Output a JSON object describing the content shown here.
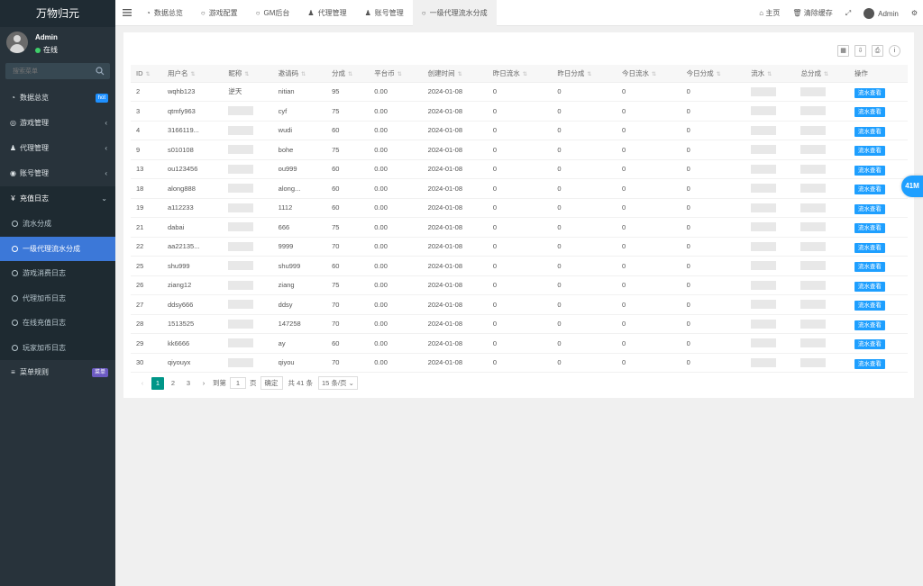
{
  "app_title": "万物归元",
  "user": {
    "name": "Admin",
    "status": "在线"
  },
  "search": {
    "placeholder": "搜索菜单"
  },
  "menu": [
    {
      "icon": "dashboard-icon",
      "glyph": "◔",
      "label": "数据总览",
      "badge": "hot"
    },
    {
      "icon": "gamepad-icon",
      "glyph": "◎",
      "label": "游戏管理",
      "arrow": "‹"
    },
    {
      "icon": "users-icon",
      "glyph": "♟",
      "label": "代理管理",
      "arrow": "‹"
    },
    {
      "icon": "user-circle-icon",
      "glyph": "◉",
      "label": "账号管理",
      "arrow": "‹"
    },
    {
      "icon": "yen-icon",
      "glyph": "¥",
      "label": "充值日志",
      "arrow": "⌄"
    }
  ],
  "submenu": [
    "流水分成",
    "一级代理流水分成",
    "游戏消费日志",
    "代理加币日志",
    "在线充值日志",
    "玩家加币日志"
  ],
  "menu_rules": {
    "label": "菜单规则",
    "badge": "菜单"
  },
  "tabs": [
    {
      "icon": "◔",
      "label": "数据总览"
    },
    {
      "icon": "○",
      "label": "游戏配置"
    },
    {
      "icon": "○",
      "label": "GM后台"
    },
    {
      "icon": "♟",
      "label": "代理管理"
    },
    {
      "icon": "♟",
      "label": "账号管理"
    },
    {
      "icon": "○",
      "label": "一级代理流水分成"
    }
  ],
  "topright": {
    "home": "主页",
    "clear_cache": "清除缓存",
    "admin": "Admin"
  },
  "table": {
    "headers": [
      "ID",
      "用户名",
      "昵称",
      "邀请码",
      "分成",
      "平台币",
      "创建时间",
      "昨日流水",
      "昨日分成",
      "今日流水",
      "今日分成",
      "流水",
      "总分成",
      "操作"
    ],
    "action_label": "流水查看",
    "rows": [
      [
        "2",
        "wqhb123",
        "逆天",
        "nitian",
        "95",
        "0.00",
        "2024-01-08",
        "0",
        "0",
        "0",
        "0"
      ],
      [
        "3",
        "qtmfy963",
        "",
        "cyf",
        "75",
        "0.00",
        "2024-01-08",
        "0",
        "0",
        "0",
        "0"
      ],
      [
        "4",
        "3166119...",
        "",
        "wudi",
        "60",
        "0.00",
        "2024-01-08",
        "0",
        "0",
        "0",
        "0"
      ],
      [
        "9",
        "s010108",
        "",
        "bohe",
        "75",
        "0.00",
        "2024-01-08",
        "0",
        "0",
        "0",
        "0"
      ],
      [
        "13",
        "ou123456",
        "",
        "ou999",
        "60",
        "0.00",
        "2024-01-08",
        "0",
        "0",
        "0",
        "0"
      ],
      [
        "18",
        "along888",
        "",
        "along...",
        "60",
        "0.00",
        "2024-01-08",
        "0",
        "0",
        "0",
        "0"
      ],
      [
        "19",
        "a112233",
        "",
        "1112",
        "60",
        "0.00",
        "2024-01-08",
        "0",
        "0",
        "0",
        "0"
      ],
      [
        "21",
        "dabai",
        "",
        "666",
        "75",
        "0.00",
        "2024-01-08",
        "0",
        "0",
        "0",
        "0"
      ],
      [
        "22",
        "aa22135...",
        "",
        "9999",
        "70",
        "0.00",
        "2024-01-08",
        "0",
        "0",
        "0",
        "0"
      ],
      [
        "25",
        "shu999",
        "",
        "shu999",
        "60",
        "0.00",
        "2024-01-08",
        "0",
        "0",
        "0",
        "0"
      ],
      [
        "26",
        "ziang12",
        "",
        "ziang",
        "75",
        "0.00",
        "2024-01-08",
        "0",
        "0",
        "0",
        "0"
      ],
      [
        "27",
        "ddsy666",
        "",
        "ddsy",
        "70",
        "0.00",
        "2024-01-08",
        "0",
        "0",
        "0",
        "0"
      ],
      [
        "28",
        "1513525",
        "",
        "147258",
        "70",
        "0.00",
        "2024-01-08",
        "0",
        "0",
        "0",
        "0"
      ],
      [
        "29",
        "kk6666",
        "",
        "ay",
        "60",
        "0.00",
        "2024-01-08",
        "0",
        "0",
        "0",
        "0"
      ],
      [
        "30",
        "qiyouyx",
        "",
        "qiyou",
        "70",
        "0.00",
        "2024-01-08",
        "0",
        "0",
        "0",
        "0"
      ]
    ]
  },
  "pager": {
    "pages": [
      "1",
      "2",
      "3"
    ],
    "current": "1",
    "goto": "到第",
    "page_value": "1",
    "page_unit": "页",
    "confirm": "确定",
    "total": "共 41 条",
    "per_page": "15 条/页"
  },
  "float_badge": "41M",
  "colors": {
    "sidebar": "#28333b",
    "active": "#3c78d8",
    "accent": "#1e9fff",
    "pager": "#009688"
  }
}
